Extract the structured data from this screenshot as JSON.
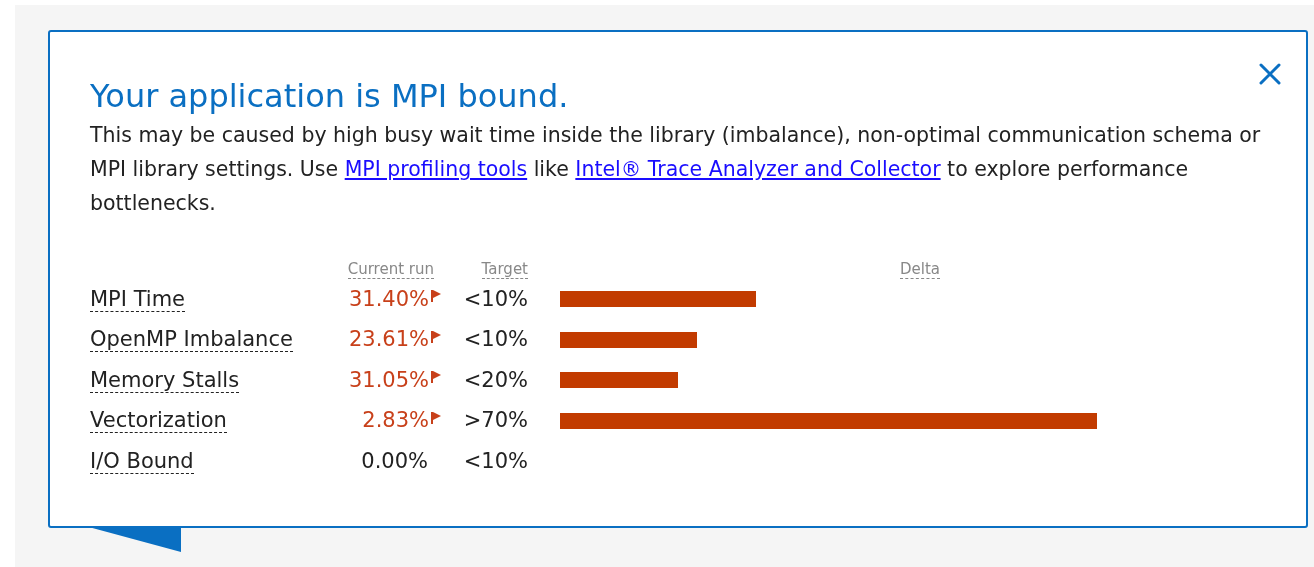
{
  "title": "Your application is MPI bound.",
  "description": [
    {
      "kind": "text",
      "text": "This may be caused by high busy wait time inside the library (imbalance), non-optimal communication schema or MPI library settings. Use "
    },
    {
      "kind": "link",
      "text": "MPI profiling tools"
    },
    {
      "kind": "text",
      "text": " like "
    },
    {
      "kind": "link",
      "text": "Intel® Trace Analyzer and Collector"
    },
    {
      "kind": "text",
      "text": " to explore performance bottlenecks."
    }
  ],
  "columns": [
    "Current run",
    "Target",
    "Delta"
  ],
  "rows": [
    {
      "name": "MPI Time",
      "current": "31.40%",
      "flagged": true,
      "target": "<10%"
    },
    {
      "name": "OpenMP Imbalance",
      "current": "23.61%",
      "flagged": true,
      "target": "<10%"
    },
    {
      "name": "Memory Stalls",
      "current": "31.05%",
      "flagged": true,
      "target": "<20%"
    },
    {
      "name": "Vectorization",
      "current": "2.83%",
      "flagged": true,
      "target": ">70%"
    },
    {
      "name": "I/O Bound",
      "current": "0.00%",
      "flagged": false,
      "target": "<10%"
    }
  ]
}
